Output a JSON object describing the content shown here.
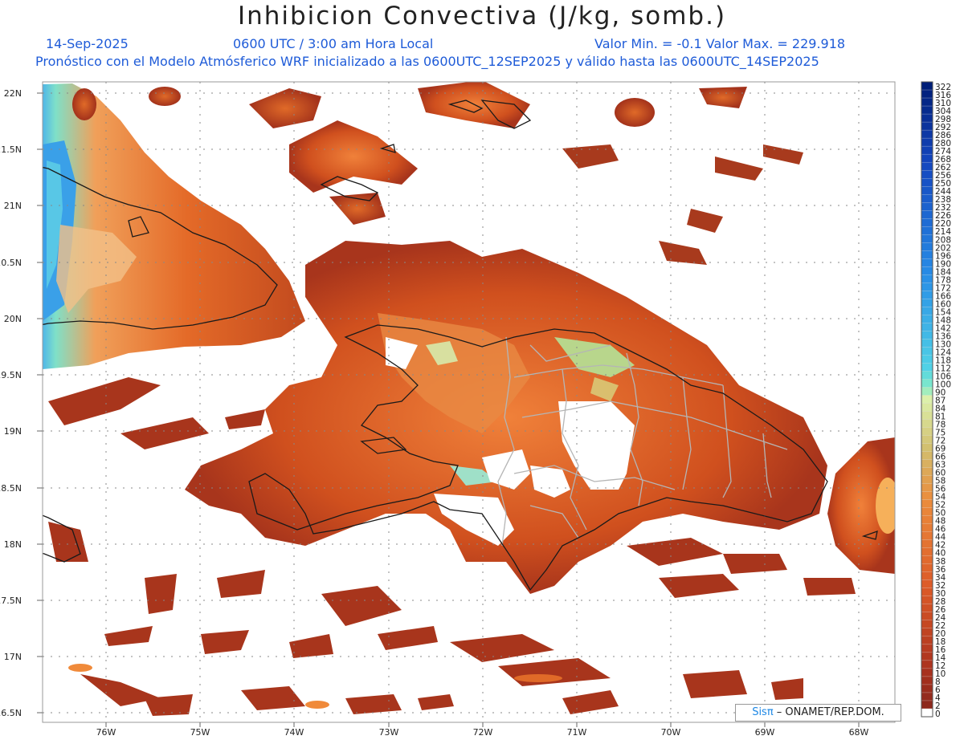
{
  "title": "Inhibicion Convectiva (J/kg, somb.)",
  "header": {
    "date": "14-Sep-2025",
    "time": "0600 UTC / 3:00 am Hora Local",
    "minmax": "Valor Min. = -0.1  Valor Max. = 229.918",
    "model_line": "Pronóstico con el Modelo Atmósferico WRF inicializado a las 0600UTC_12SEP2025 y válido hasta las  0600UTC_14SEP2025"
  },
  "axes": {
    "lat_labels": [
      "22N",
      "21.5N",
      "21N",
      "20.5N",
      "20N",
      "19.5N",
      "19N",
      "18.5N",
      "18N",
      "17.5N",
      "17N",
      "16.5N"
    ],
    "lon_labels": [
      "76W",
      "75W",
      "74W",
      "73W",
      "72W",
      "71W",
      "70W",
      "69W",
      "68W"
    ]
  },
  "colorbar": {
    "labels": [
      "322",
      "316",
      "310",
      "304",
      "298",
      "292",
      "286",
      "280",
      "274",
      "268",
      "262",
      "256",
      "250",
      "244",
      "238",
      "232",
      "226",
      "220",
      "214",
      "208",
      "202",
      "196",
      "190",
      "184",
      "178",
      "172",
      "166",
      "160",
      "154",
      "148",
      "142",
      "136",
      "130",
      "124",
      "118",
      "112",
      "106",
      "100",
      "90",
      "87",
      "84",
      "81",
      "78",
      "75",
      "72",
      "69",
      "66",
      "63",
      "60",
      "58",
      "56",
      "54",
      "52",
      "50",
      "48",
      "46",
      "44",
      "42",
      "40",
      "38",
      "36",
      "34",
      "32",
      "30",
      "28",
      "26",
      "24",
      "22",
      "20",
      "18",
      "16",
      "14",
      "12",
      "10",
      "8",
      "6",
      "4",
      "2",
      "0"
    ]
  },
  "credit": {
    "sis": "Sisπ",
    "rest": " – ONAMET/REP.DOM."
  },
  "colors": {
    "low": "#9a2e1c",
    "mid": "#e0601e",
    "high": "#c9d77c",
    "cyan": "#6fe3d4",
    "blue": "#1f6fe0",
    "border": "#1a1a1a",
    "provinces": "#b5b5b5"
  }
}
